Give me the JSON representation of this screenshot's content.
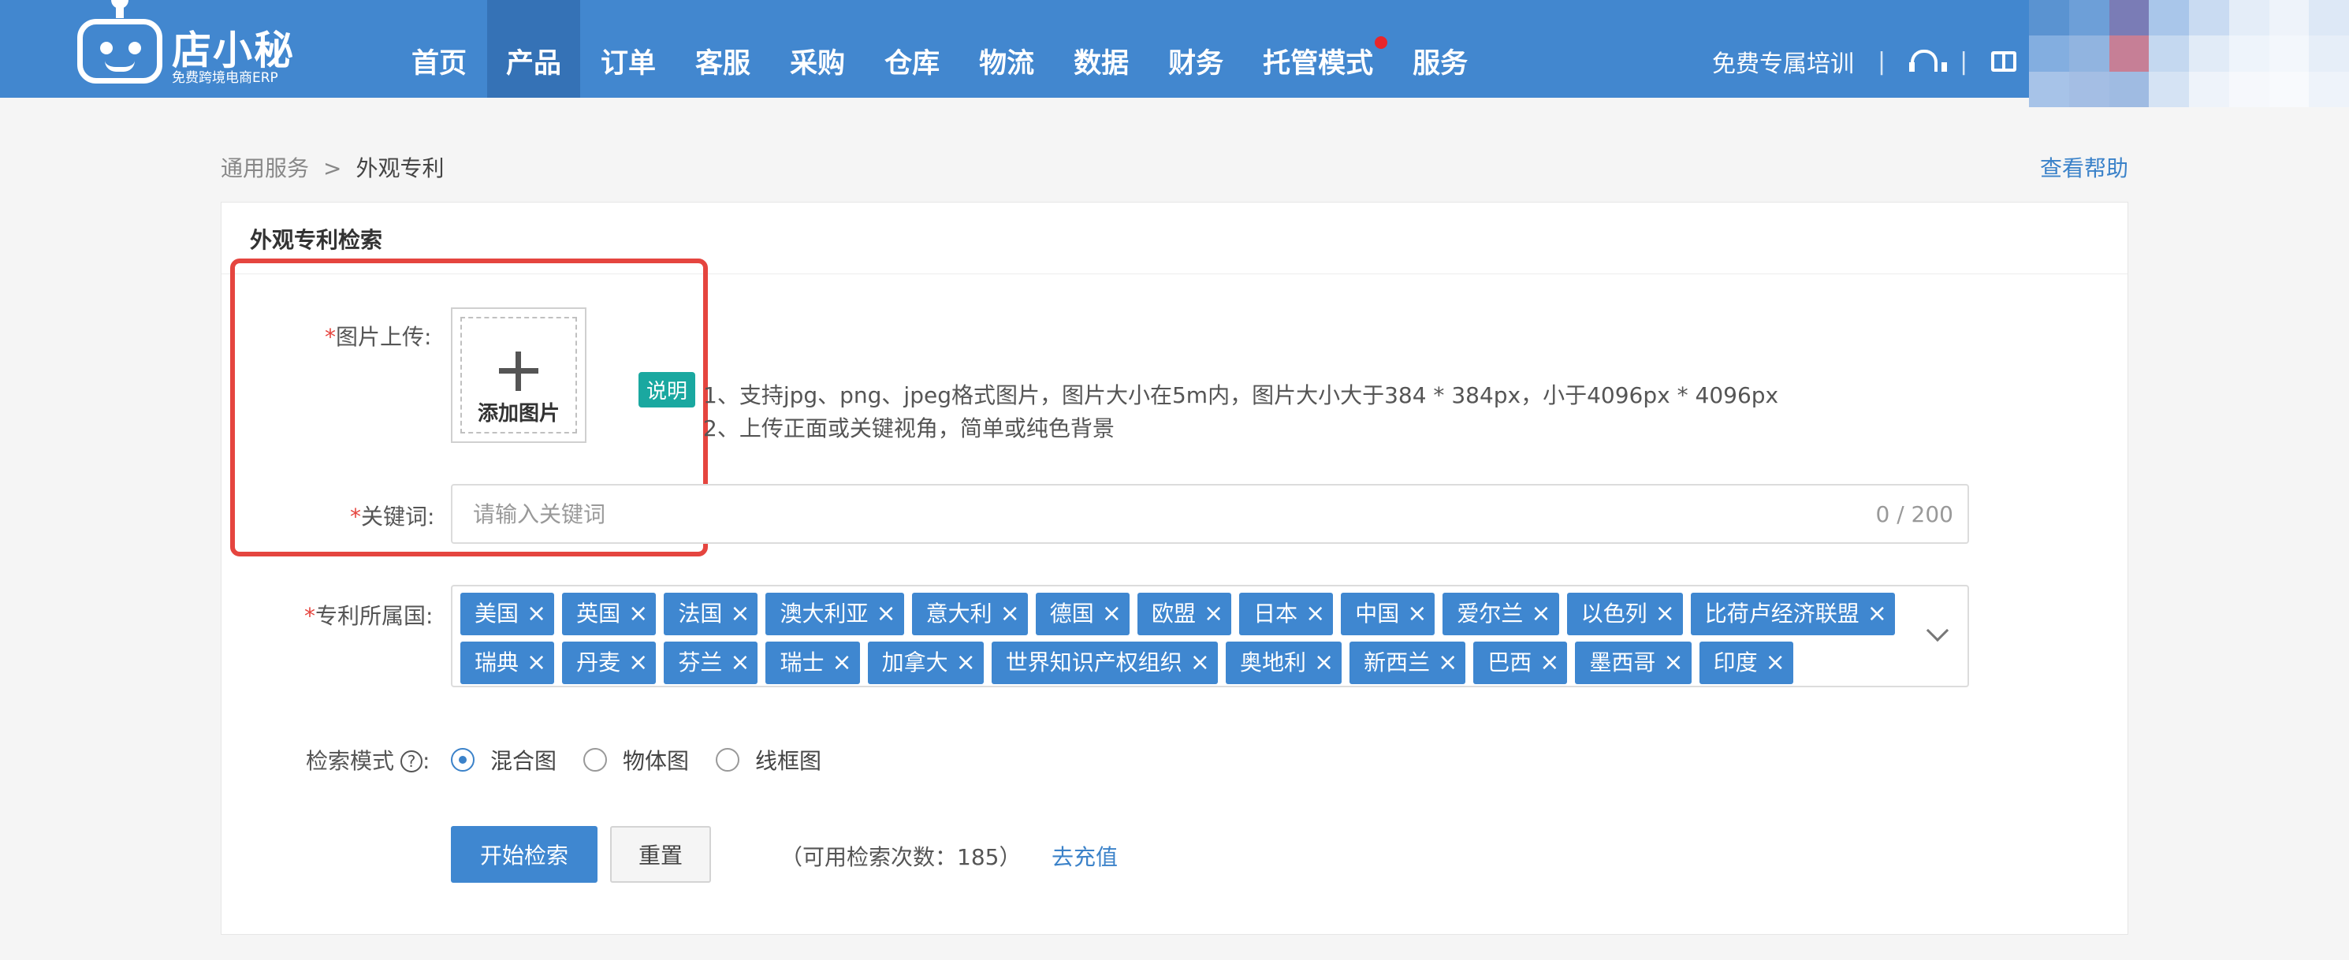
{
  "brand": {
    "name": "店小秘",
    "tagline": "免费跨境电商ERP"
  },
  "nav": {
    "items": [
      {
        "label": "首页",
        "active": false
      },
      {
        "label": "产品",
        "active": true
      },
      {
        "label": "订单",
        "active": false
      },
      {
        "label": "客服",
        "active": false
      },
      {
        "label": "采购",
        "active": false
      },
      {
        "label": "仓库",
        "active": false
      },
      {
        "label": "物流",
        "active": false
      },
      {
        "label": "数据",
        "active": false
      },
      {
        "label": "财务",
        "active": false
      },
      {
        "label": "托管模式",
        "active": false,
        "dot": true
      },
      {
        "label": "服务",
        "active": false
      }
    ],
    "training": "免费专属培训",
    "separator": "|",
    "headset_icon": "headset-icon",
    "book_icon": "book-icon"
  },
  "colors": {
    "nav_bg": "#4287cf",
    "nav_active": "#3572b6",
    "tag_bg": "#3f87d0",
    "highlight": "#e5453f",
    "badge_bg": "#1aa8a0",
    "link": "#3b82c9"
  },
  "breadcrumb": {
    "parent": "通用服务",
    "separator": ">",
    "current": "外观专利"
  },
  "help_link": "查看帮助",
  "panel": {
    "title": "外观专利检索"
  },
  "form": {
    "required_mark": "*",
    "image_label": "图片上传",
    "colon": ":",
    "upload_text": "添加图片",
    "note_badge": "说明",
    "notes": [
      "1、支持jpg、png、jpeg格式图片，图片大小在5m内，图片大小大于384 * 384px，小于4096px * 4096px",
      "2、上传正面或关键视角，简单或纯色背景"
    ],
    "keyword_label": "关键词",
    "keyword_placeholder": "请输入关键词",
    "keyword_value": "",
    "keyword_counter": "0 / 200",
    "country_label": "专利所属国",
    "countries_row1": [
      "美国",
      "英国",
      "法国",
      "澳大利亚",
      "意大利",
      "德国",
      "欧盟",
      "日本",
      "中国",
      "爱尔兰",
      "以色列",
      "比荷卢经济联盟"
    ],
    "countries_row2": [
      "瑞典",
      "丹麦",
      "芬兰",
      "瑞士",
      "加拿大",
      "世界知识产权组织",
      "奥地利",
      "新西兰",
      "巴西",
      "墨西哥",
      "印度"
    ],
    "remove_glyph": "×",
    "mode_label": "检索模式",
    "mode_help": "?",
    "modes": [
      {
        "label": "混合图",
        "checked": true
      },
      {
        "label": "物体图",
        "checked": false
      },
      {
        "label": "线框图",
        "checked": false
      }
    ],
    "search_button": "开始检索",
    "reset_button": "重置",
    "remaining": "（可用检索次数：185）",
    "recharge": "去充值"
  }
}
